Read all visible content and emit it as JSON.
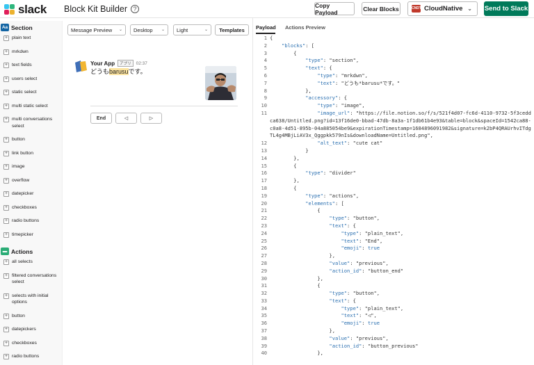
{
  "header": {
    "logo_text": "slack",
    "title": "Block Kit Builder",
    "copy_payload": "Copy Payload",
    "clear_blocks": "Clear Blocks",
    "workspace_icon": "CNDT",
    "workspace_name": "CloudNative",
    "send_label": "Send to Slack",
    "colors": {
      "send": "#007a5a",
      "section_icon": "#1264a3",
      "actions_icon": "#2bac76"
    }
  },
  "sidebar": {
    "section_icon": "Aa",
    "section_title": "Section",
    "section_items": [
      "plain text",
      "mrkdwn",
      "text fields",
      "users select",
      "static select",
      "multi static select",
      "multi conversations select",
      "button",
      "link button",
      "image",
      "overflow",
      "datepicker",
      "checkboxes",
      "radio buttons",
      "timepicker"
    ],
    "actions_title": "Actions",
    "actions_items": [
      "all selects",
      "filtered conversations select",
      "selects with initial options",
      "button",
      "datepickers",
      "checkboxes",
      "radio buttons"
    ]
  },
  "preview": {
    "surface": "Message Preview",
    "device": "Desktop",
    "theme": "Light",
    "templates": "Templates",
    "app_name": "Your App",
    "app_badge": "アプリ",
    "time": "02:37",
    "text_before": "どうも",
    "text_bold": "barusu",
    "text_after": "です。",
    "btn_end": "End",
    "btn_prev": "◁",
    "btn_next": "▷"
  },
  "payload": {
    "tab_payload": "Payload",
    "tab_actions": "Actions Preview",
    "lines": [
      {
        "n": "1",
        "t": "{"
      },
      {
        "n": "2",
        "t": "    \"blocks\": ["
      },
      {
        "n": "3",
        "t": "        {"
      },
      {
        "n": "4",
        "t": "            \"type\": \"section\","
      },
      {
        "n": "5",
        "t": "            \"text\": {"
      },
      {
        "n": "6",
        "t": "                \"type\": \"mrkdwn\","
      },
      {
        "n": "7",
        "t": "                \"text\": \"どうも*barusu*です。\""
      },
      {
        "n": "8",
        "t": "            },"
      },
      {
        "n": "9",
        "t": "            \"accessory\": {"
      },
      {
        "n": "10",
        "t": "                \"type\": \"image\","
      },
      {
        "n": "11",
        "t": "                \"image_url\": \"https://file.notion.so/f/s/521f4d07-fc6d-4110-9732-5f3ceddca638/Untitled.png?id=13f16de0-bbad-47db-8a3a-1f1db61b4e93&table=block&spaceId=1542ca88-c0a8-4d51-895b-04a885054be9&expirationTimestamp=1684896091982&signature=k2bP4QRAUrhvITdgTL4g4MBjLiAV3x_Qggpkk579nIs&downloadName=Untitled.png\","
      },
      {
        "n": "12",
        "t": "                \"alt_text\": \"cute cat\""
      },
      {
        "n": "13",
        "t": "            }"
      },
      {
        "n": "14",
        "t": "        },"
      },
      {
        "n": "15",
        "t": "        {"
      },
      {
        "n": "16",
        "t": "            \"type\": \"divider\""
      },
      {
        "n": "17",
        "t": "        },"
      },
      {
        "n": "18",
        "t": "        {"
      },
      {
        "n": "19",
        "t": "            \"type\": \"actions\","
      },
      {
        "n": "20",
        "t": "            \"elements\": ["
      },
      {
        "n": "21",
        "t": "                {"
      },
      {
        "n": "22",
        "t": "                    \"type\": \"button\","
      },
      {
        "n": "23",
        "t": "                    \"text\": {"
      },
      {
        "n": "24",
        "t": "                        \"type\": \"plain_text\","
      },
      {
        "n": "25",
        "t": "                        \"text\": \"End\","
      },
      {
        "n": "26",
        "t": "                        \"emoji\": true"
      },
      {
        "n": "27",
        "t": "                    },"
      },
      {
        "n": "28",
        "t": "                    \"value\": \"previous\","
      },
      {
        "n": "29",
        "t": "                    \"action_id\": \"button_end\""
      },
      {
        "n": "30",
        "t": "                },"
      },
      {
        "n": "31",
        "t": "                {"
      },
      {
        "n": "32",
        "t": "                    \"type\": \"button\","
      },
      {
        "n": "33",
        "t": "                    \"text\": {"
      },
      {
        "n": "34",
        "t": "                        \"type\": \"plain_text\","
      },
      {
        "n": "35",
        "t": "                        \"text\": \"◁\","
      },
      {
        "n": "36",
        "t": "                        \"emoji\": true"
      },
      {
        "n": "37",
        "t": "                    },"
      },
      {
        "n": "38",
        "t": "                    \"value\": \"previous\","
      },
      {
        "n": "39",
        "t": "                    \"action_id\": \"button_previous\""
      },
      {
        "n": "40",
        "t": "                },"
      }
    ]
  }
}
